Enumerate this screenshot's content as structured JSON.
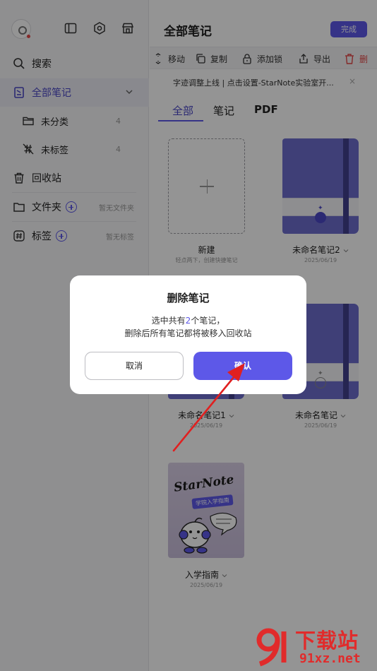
{
  "sidebar": {
    "nav": {
      "search": "搜索",
      "all_notes": "全部笔记",
      "uncategorized": "未分类",
      "uncategorized_count": "4",
      "untagged": "未标签",
      "untagged_count": "4",
      "trash": "回收站",
      "folders": "文件夹",
      "folders_hint": "暂无文件夹",
      "tags": "标签",
      "tags_hint": "暂无标签"
    },
    "top_icons": [
      "app-logo-icon",
      "sidebar-toggle-icon",
      "settings-icon",
      "store-icon"
    ]
  },
  "main": {
    "title": "全部笔记",
    "done_label": "完成",
    "toolbar": {
      "move": "移动",
      "copy": "复制",
      "add_lock": "添加锁",
      "export": "导出",
      "delete": "删"
    },
    "banner": {
      "text": "字迹调整上线 | 点击设置-StarNote实验室开...",
      "close": "×"
    },
    "tabs": [
      "全部",
      "笔记",
      "PDF"
    ],
    "new_card": {
      "label": "新建",
      "hint": "轻点两下，创建快捷笔记"
    },
    "notes": [
      {
        "title": "未命名笔记2",
        "date": "2025/06/19"
      },
      {
        "title": "未命名笔记1",
        "date": "2025/06/19"
      },
      {
        "title": "未命名笔记",
        "date": "2025/06/19"
      },
      {
        "title": "入学指南",
        "date": "2025/06/19"
      }
    ],
    "guide_cover": {
      "title": "StarNote",
      "tag": "学院入学指南"
    }
  },
  "dialog": {
    "title": "删除笔记",
    "message_prefix": "选中共有",
    "message_count": "2",
    "message_suffix": "个笔记，",
    "message_line2": "删除后所有笔记都将被移入回收站",
    "cancel": "取消",
    "confirm": "确认"
  },
  "watermark": {
    "title": "下载站",
    "url": "91xz.net"
  },
  "colors": {
    "accent": "#5d58e8",
    "danger": "#e34848",
    "annotation_arrow": "#e02020",
    "watermark": "#e12b2b"
  }
}
